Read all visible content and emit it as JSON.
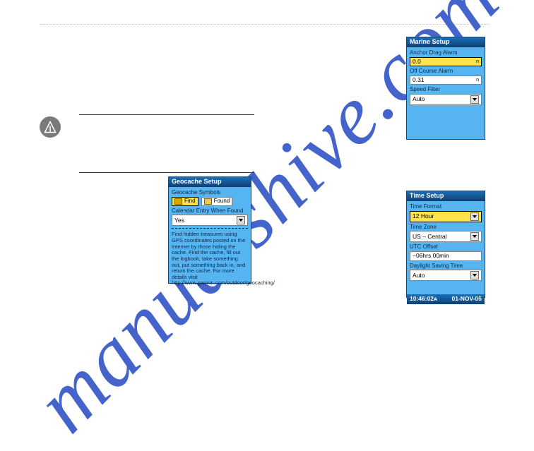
{
  "watermark": "manualshive.com",
  "marine": {
    "title": "Marine Setup",
    "anchor_label": "Anchor Drag Alarm",
    "anchor_value": "0.0",
    "anchor_unit": "n",
    "off_course_label": "Off Course Alarm",
    "off_course_value": "0.31",
    "off_course_unit": "n",
    "speed_filter_label": "Speed Filter",
    "speed_filter_value": "Auto"
  },
  "geocache": {
    "title": "Geocache Setup",
    "symbols_label": "Geocache Symbols",
    "find_label": "Find",
    "found_label": "Found",
    "calendar_label": "Calendar Entry When Found",
    "calendar_value": "Yes",
    "help_text": "Find hidden treasures using GPS coordinates posted on the Internet by those hiding the cache. Find the cache, fill out the logbook, take something out, put something back in, and return the cache. For more details visit http://www.garmin.com/outdoor/geocaching/"
  },
  "time": {
    "title": "Time Setup",
    "format_label": "Time Format",
    "format_value": "12 Hour",
    "zone_label": "Time Zone",
    "zone_value": "US – Central",
    "utc_label": "UTC Offset",
    "utc_value": "−06hrs 00min",
    "dst_label": "Daylight Saving Time",
    "dst_value": "Auto",
    "status_time": "10:46:02ᴀ",
    "status_date": "01-NOV-05"
  }
}
